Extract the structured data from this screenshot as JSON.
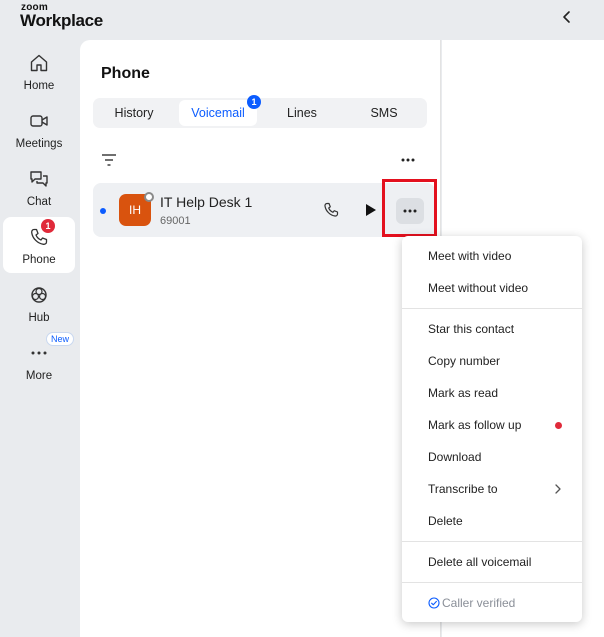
{
  "app": {
    "logo_small": "zoom",
    "logo_big": "Workplace"
  },
  "nav": {
    "items": [
      {
        "label": "Home"
      },
      {
        "label": "Meetings"
      },
      {
        "label": "Chat"
      },
      {
        "label": "Phone",
        "badge": "1"
      },
      {
        "label": "Hub"
      },
      {
        "label": "More"
      }
    ],
    "new_badge": "New"
  },
  "phone": {
    "title": "Phone",
    "tabs": [
      {
        "label": "History"
      },
      {
        "label": "Voicemail",
        "badge": "1"
      },
      {
        "label": "Lines"
      },
      {
        "label": "SMS"
      }
    ],
    "voicemail": {
      "initials": "IH",
      "name": "IT Help Desk 1",
      "number": "69001"
    }
  },
  "menu": {
    "items": [
      "Meet with video",
      "Meet without video",
      "Star this contact",
      "Copy number",
      "Mark as read",
      "Mark as follow up",
      "Download",
      "Transcribe to",
      "Delete",
      "Delete all voicemail"
    ],
    "verified": "Caller verified"
  },
  "colors": {
    "accent": "#0b5cff",
    "avatar": "#d9530e",
    "badge_red": "#e02a3a",
    "highlight": "#e3101e"
  }
}
